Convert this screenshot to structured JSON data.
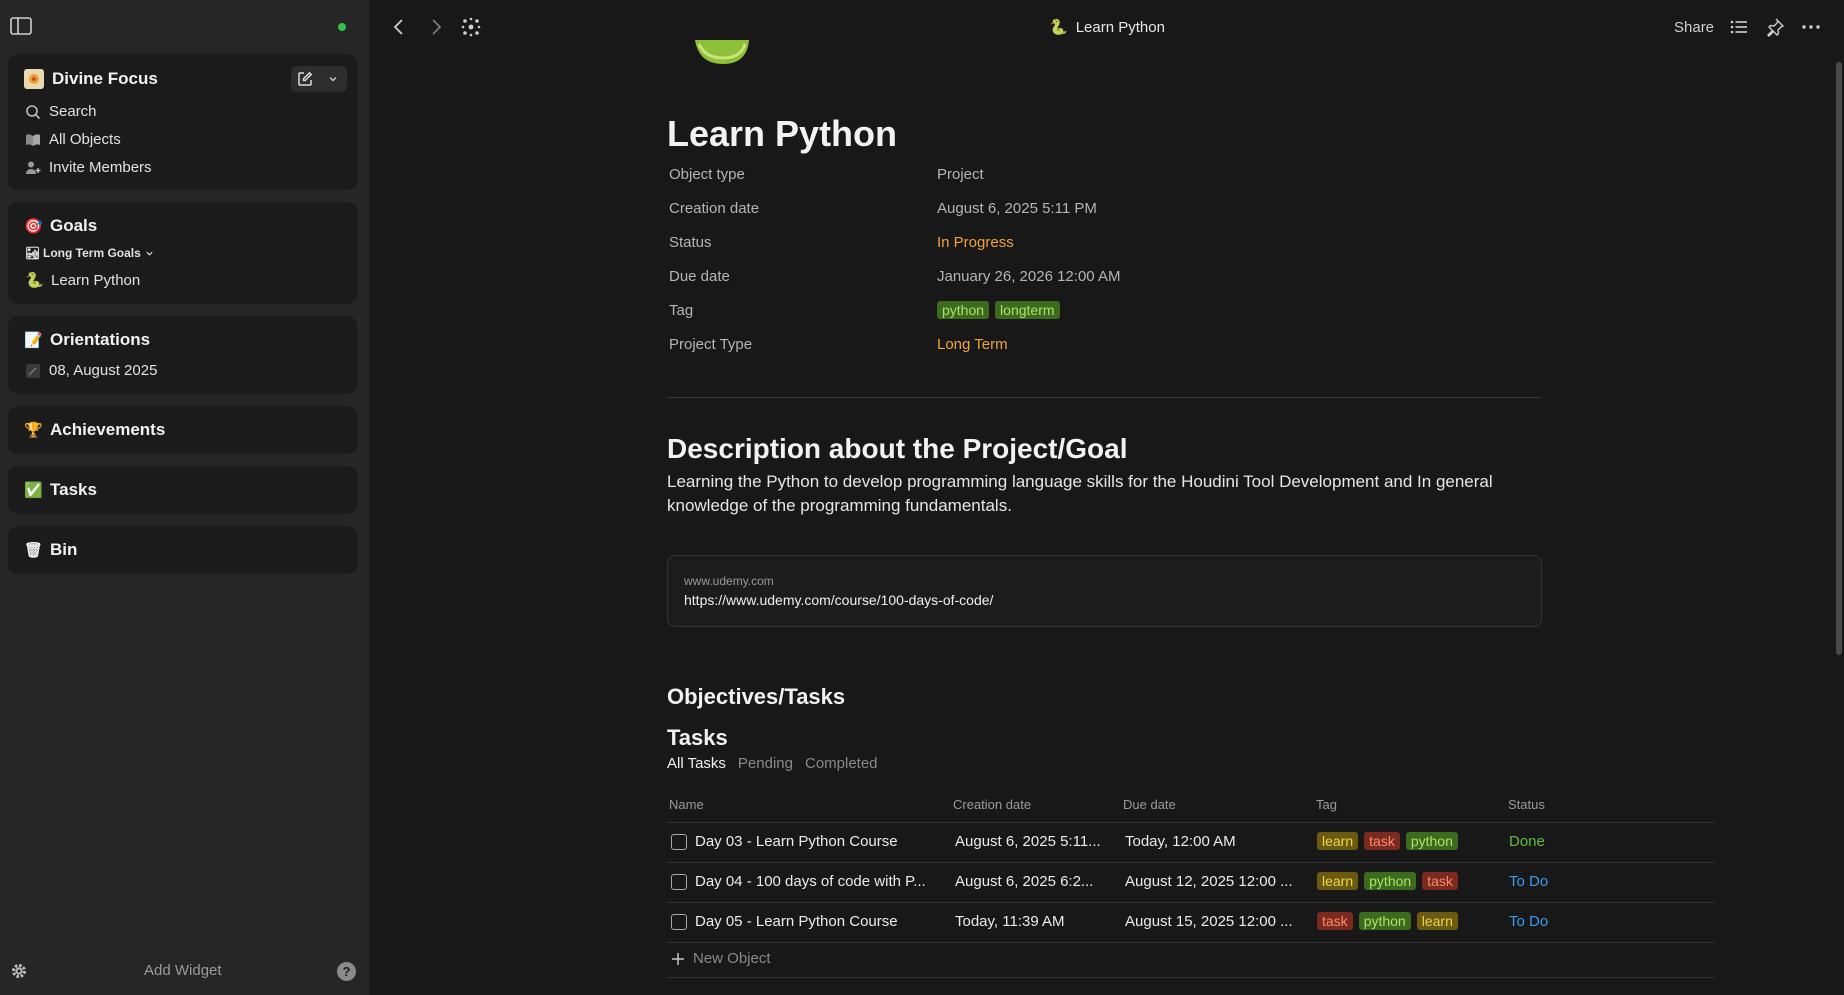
{
  "sidebar": {
    "space": {
      "name": "Divine Focus",
      "icon": "space-logo-icon"
    },
    "nav": [
      {
        "label": "Search",
        "icon": "search-icon"
      },
      {
        "label": "All Objects",
        "icon": "book-icon"
      },
      {
        "label": "Invite Members",
        "icon": "invite-members-icon"
      }
    ],
    "goals": {
      "title": "Goals",
      "emoji": "🎯",
      "group": "Long Term Goals",
      "group_emoji": "🏜",
      "item": "Learn Python",
      "item_emoji": "🐍"
    },
    "orientations": {
      "title": "Orientations",
      "emoji": "📝",
      "item": "08, August 2025"
    },
    "achievements": {
      "title": "Achievements",
      "emoji": "🏆"
    },
    "tasks": {
      "title": "Tasks",
      "emoji": "✅"
    },
    "bin": {
      "title": "Bin",
      "emoji": "🗑"
    },
    "add_widget": "Add Widget",
    "help": "?"
  },
  "topbar": {
    "title": "Learn Python",
    "title_emoji": "🐍",
    "share": "Share"
  },
  "page": {
    "cover_emoji": "🐍",
    "title": "Learn Python",
    "relations": [
      {
        "key": "Object type",
        "value": "Project"
      },
      {
        "key": "Creation date",
        "value": "August 6, 2025 5:11 PM"
      },
      {
        "key": "Status",
        "value": "In Progress"
      },
      {
        "key": "Due date",
        "value": "January 26, 2026 12:00 AM"
      },
      {
        "key": "Tag",
        "tags": [
          "python",
          "longterm"
        ]
      },
      {
        "key": "Project Type",
        "value": "Long Term"
      }
    ],
    "description_heading": "Description about the Project/Goal",
    "description": "Learning the Python to develop programming language skills for the Houdini Tool Development and In general knowledge of the programming fundamentals.",
    "bookmark": {
      "host": "www.udemy.com",
      "url": "https://www.udemy.com/course/100-days-of-code/"
    },
    "objectives_heading": "Objectives/Tasks",
    "set_heading": "Tasks",
    "views": [
      "All Tasks",
      "Pending",
      "Completed"
    ],
    "columns": [
      "Name",
      "Creation date",
      "Due date",
      "Tag",
      "Status"
    ],
    "rows": [
      {
        "name": "Day 03 - Learn Python Course",
        "created": "August 6, 2025 5:11...",
        "due": "Today, 12:00 AM",
        "tags": [
          "learn",
          "task",
          "python"
        ],
        "status": "Done"
      },
      {
        "name": "Day 04 - 100 days of code with P...",
        "created": "August 6, 2025 6:2...",
        "due": "August 12, 2025 12:00 ...",
        "tags": [
          "learn",
          "python",
          "task"
        ],
        "status": "To Do"
      },
      {
        "name": "Day 05 - Learn Python Course",
        "created": "Today, 11:39 AM",
        "due": "August 15, 2025 12:00 ...",
        "tags": [
          "task",
          "python",
          "learn"
        ],
        "status": "To Do"
      }
    ],
    "new_object": "New Object"
  },
  "colors": {
    "accent_orange": "#f2a33a",
    "status_done": "#5fbf3a",
    "status_todo": "#3d9bf0",
    "online_dot": "#34c24a"
  }
}
